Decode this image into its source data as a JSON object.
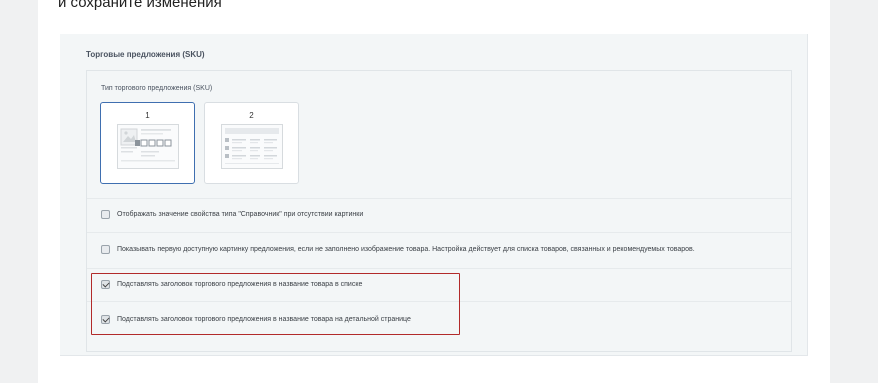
{
  "header": {
    "instruction_tail": "и сохраните изменения"
  },
  "panel": {
    "title": "Торговые предложения (SKU)",
    "sku_type_label": "Тип торгового предложения (SKU)",
    "sku_options": [
      {
        "number": "1",
        "selected": true
      },
      {
        "number": "2",
        "selected": false
      }
    ],
    "options": [
      {
        "label": "Отображать значение свойства типа \"Справочник\" при отсутствии картинки",
        "checked": false
      },
      {
        "label": "Показывать первую доступную картинку предложения, если не заполнено изображение товара. Настройка действует для списка товаров, связанных и рекомендуемых товаров.",
        "checked": false
      },
      {
        "label": "Подставлять заголовок торгового предложения в название товара в списке",
        "checked": true
      },
      {
        "label": "Подставлять заголовок торгового предложения в название товара на детальной странице",
        "checked": true
      }
    ]
  },
  "colors": {
    "selected_border": "#3f6fb0",
    "highlight": "#b22a2a",
    "panel_bg": "#f3f6f7"
  }
}
